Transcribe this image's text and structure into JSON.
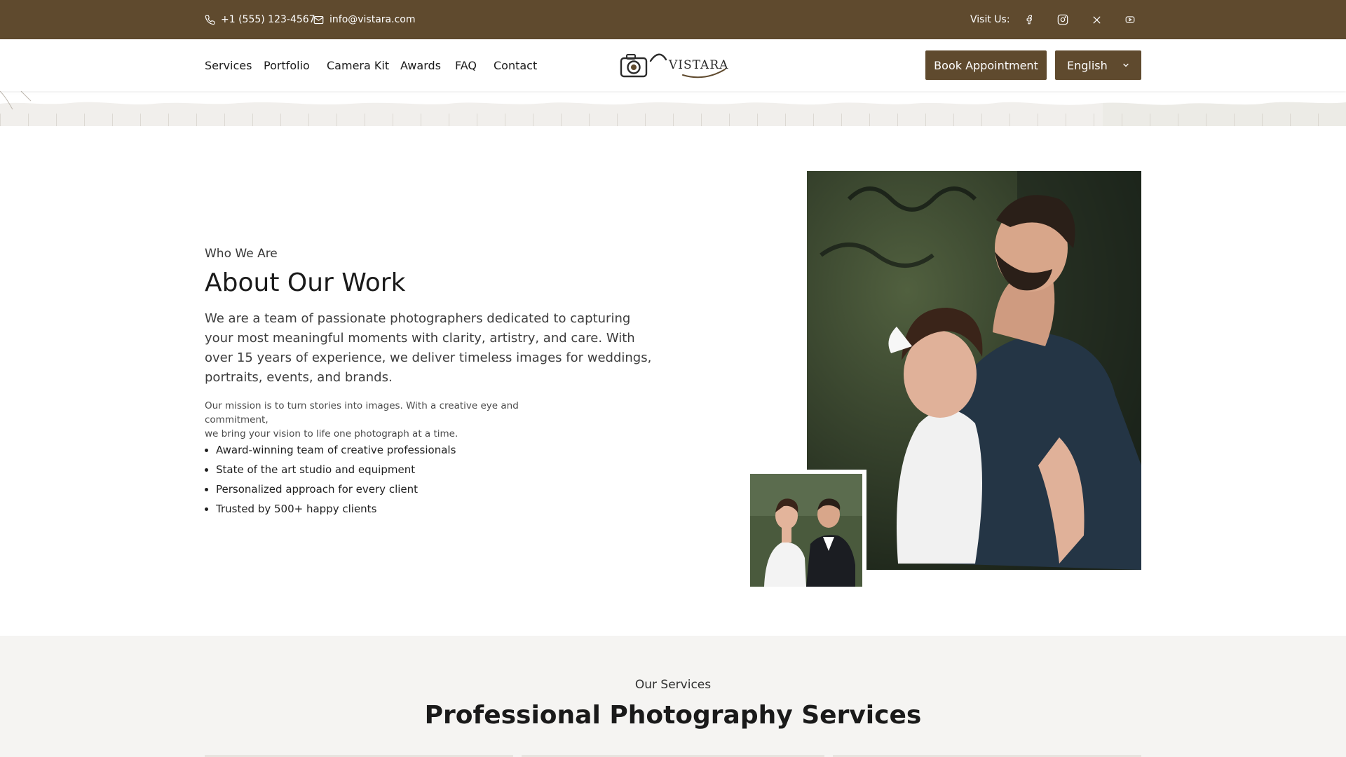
{
  "topbar": {
    "phone": "+1 (555) 123-4567",
    "email": "info@vistara.com",
    "visit_label": "Visit Us:",
    "socials": [
      "facebook-icon",
      "instagram-icon",
      "x-icon",
      "youtube-icon"
    ]
  },
  "nav": {
    "links": [
      "Services",
      "Portfolio",
      "Camera Kit",
      "Awards",
      "FAQ",
      "Contact"
    ],
    "logo_text": "VISTARA",
    "book_label": "Book Appointment",
    "language": "English"
  },
  "about": {
    "eyebrow": "Who We Are",
    "title": "About Our Work",
    "lead": "We are a team of passionate photographers dedicated to capturing your most meaningful moments with clarity, artistry, and care. With over 15 years of experience, we deliver timeless images for weddings, portraits, events, and brands.",
    "sub_line1": "Our mission is to turn stories into images. With a creative eye and commitment,",
    "sub_line2": "we bring your vision to life one photograph at a time.",
    "bullets": [
      "Award-winning team of creative professionals",
      "State of the art studio and equipment",
      "Personalized approach for every client",
      "Trusted by 500+ happy clients"
    ]
  },
  "services": {
    "eyebrow": "Our Services",
    "title": "Professional Photography Services"
  },
  "colors": {
    "brand_brown": "#5f4a2e",
    "section_bg": "#f5f4f2"
  }
}
